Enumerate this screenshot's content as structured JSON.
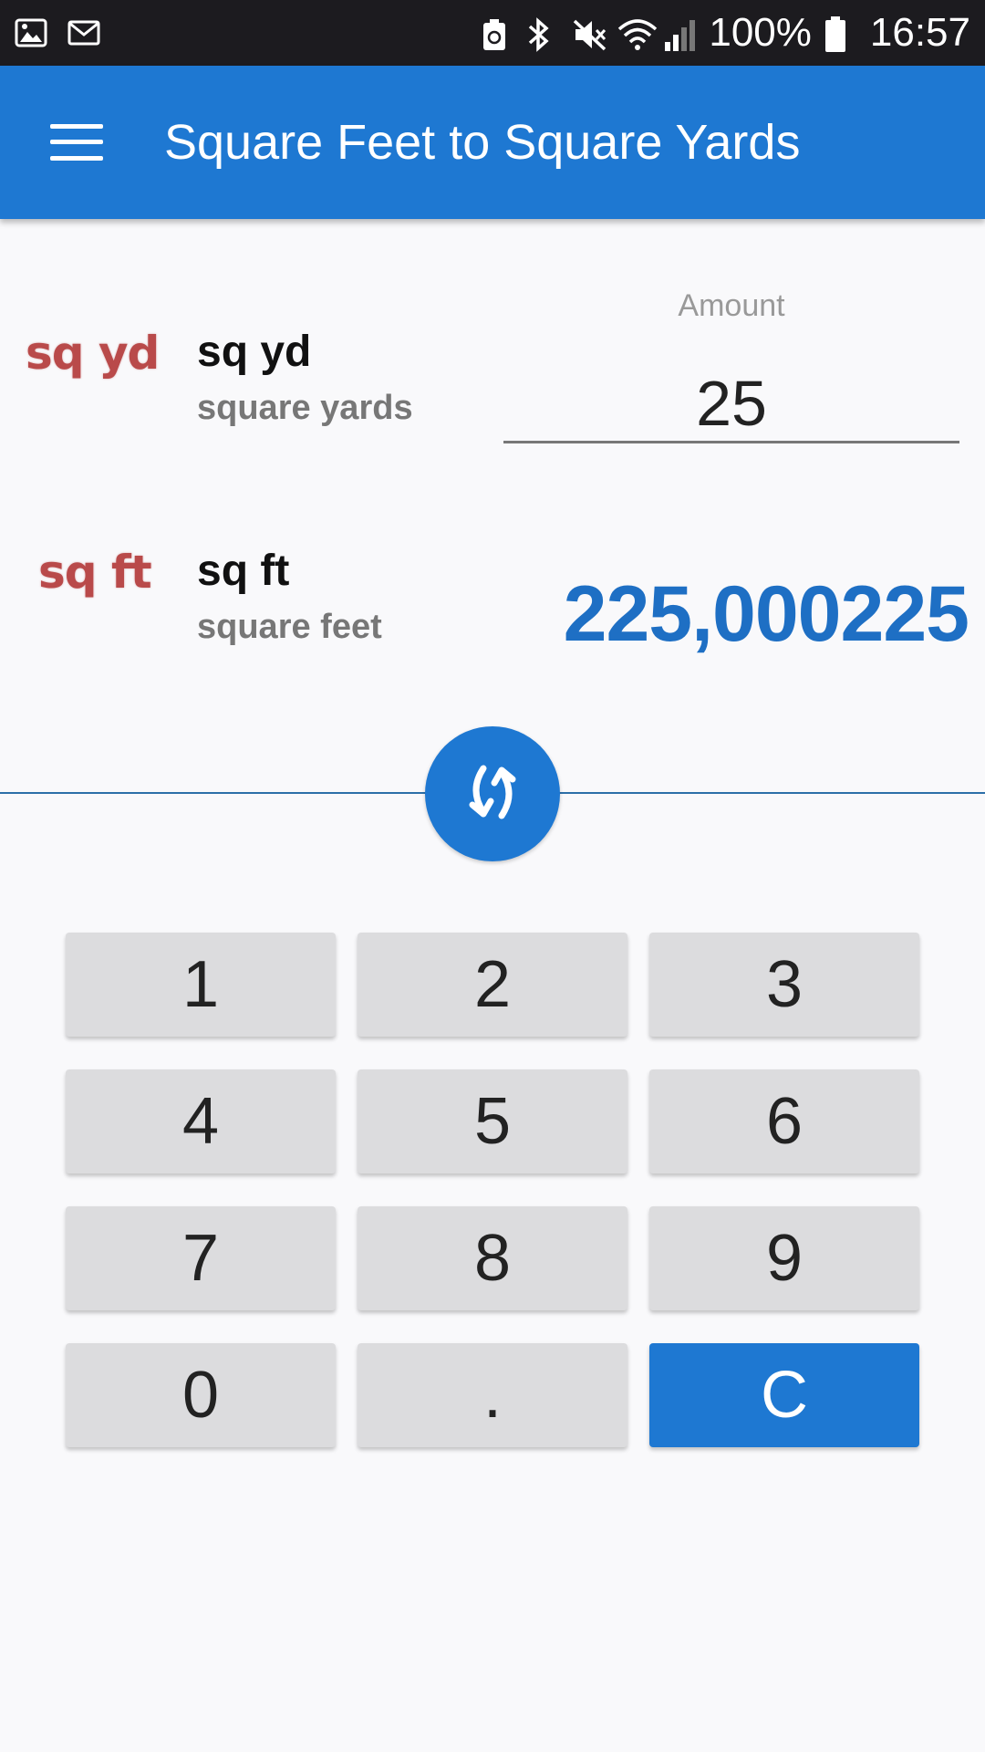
{
  "status_bar": {
    "battery": "100%",
    "time": "16:57",
    "icons": [
      "image-icon",
      "gmail-icon",
      "recycle-icon",
      "bluetooth-icon",
      "mute-icon",
      "wifi-icon",
      "signal-icon",
      "battery-icon"
    ]
  },
  "app_bar": {
    "title": "Square Feet to Square Yards",
    "menu_icon": "hamburger-menu-icon"
  },
  "from_unit": {
    "logo": "sq yd",
    "abbr": "sq yd",
    "name": "square yards",
    "amount_label": "Amount",
    "amount_value": "25"
  },
  "to_unit": {
    "logo": "sq ft",
    "abbr": "sq ft",
    "name": "square feet",
    "result": "225,000225"
  },
  "swap": {
    "icon": "swap-arrows-icon"
  },
  "keypad": {
    "keys": [
      "1",
      "2",
      "3",
      "4",
      "5",
      "6",
      "7",
      "8",
      "9",
      "0",
      ".",
      "C"
    ]
  },
  "colors": {
    "primary": "#1e78d2",
    "status_bar": "#1c1b1f",
    "result_text": "#1e6fc4",
    "unit_logo": "#b94a4a",
    "key_background": "#dcdcde"
  }
}
